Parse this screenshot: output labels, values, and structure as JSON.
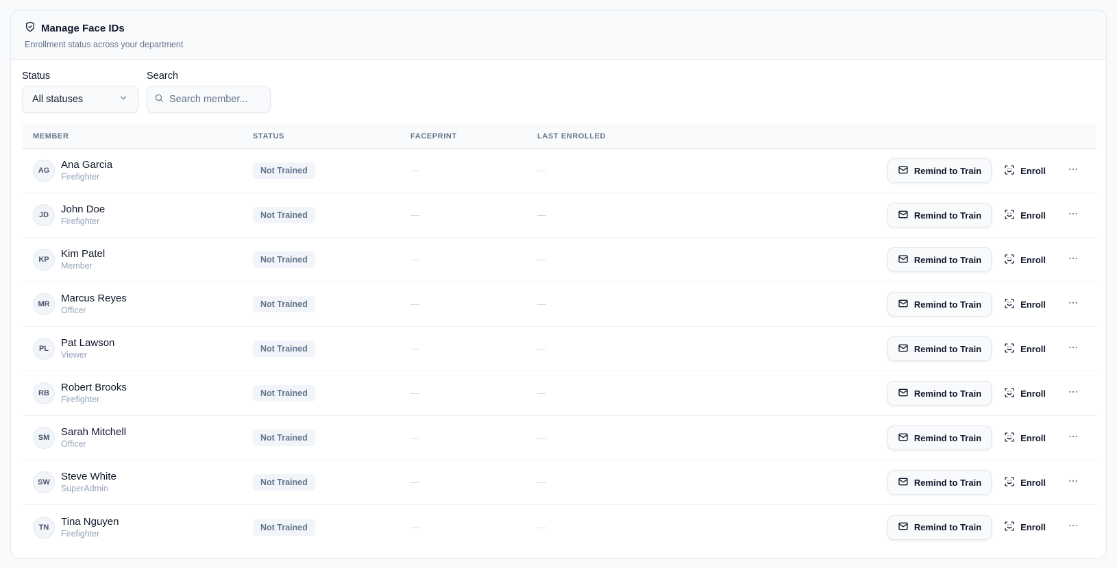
{
  "header": {
    "title": "Manage Face IDs",
    "subtitle": "Enrollment status across your department",
    "icon": "shield-check-icon"
  },
  "filters": {
    "status_label": "Status",
    "status_value": "All statuses",
    "search_label": "Search",
    "search_placeholder": "Search member..."
  },
  "table": {
    "columns": {
      "member": "MEMBER",
      "status": "STATUS",
      "faceprint": "FACEPRINT",
      "last_enrolled": "LAST ENROLLED"
    },
    "rows": [
      {
        "initials": "AG",
        "name": "Ana Garcia",
        "role": "Firefighter",
        "status": "Not Trained",
        "faceprint": "—",
        "last_enrolled": "—"
      },
      {
        "initials": "JD",
        "name": "John Doe",
        "role": "Firefighter",
        "status": "Not Trained",
        "faceprint": "—",
        "last_enrolled": "—"
      },
      {
        "initials": "KP",
        "name": "Kim Patel",
        "role": "Member",
        "status": "Not Trained",
        "faceprint": "—",
        "last_enrolled": "—"
      },
      {
        "initials": "MR",
        "name": "Marcus Reyes",
        "role": "Officer",
        "status": "Not Trained",
        "faceprint": "—",
        "last_enrolled": "—"
      },
      {
        "initials": "PL",
        "name": "Pat Lawson",
        "role": "Viewer",
        "status": "Not Trained",
        "faceprint": "—",
        "last_enrolled": "—"
      },
      {
        "initials": "RB",
        "name": "Robert Brooks",
        "role": "Firefighter",
        "status": "Not Trained",
        "faceprint": "—",
        "last_enrolled": "—"
      },
      {
        "initials": "SM",
        "name": "Sarah Mitchell",
        "role": "Officer",
        "status": "Not Trained",
        "faceprint": "—",
        "last_enrolled": "—"
      },
      {
        "initials": "SW",
        "name": "Steve White",
        "role": "SuperAdmin",
        "status": "Not Trained",
        "faceprint": "—",
        "last_enrolled": "—"
      },
      {
        "initials": "TN",
        "name": "Tina Nguyen",
        "role": "Firefighter",
        "status": "Not Trained",
        "faceprint": "—",
        "last_enrolled": "—"
      }
    ]
  },
  "actions": {
    "remind_label": "Remind to Train",
    "remind_icon": "mail-icon",
    "enroll_label": "Enroll",
    "enroll_icon": "face-scan-icon",
    "more_icon": "more-horizontal-icon"
  },
  "colors": {
    "text_primary": "#0f172a",
    "text_muted": "#64748b",
    "badge_bg": "#f1f5f9",
    "border": "#e2e8f0"
  }
}
